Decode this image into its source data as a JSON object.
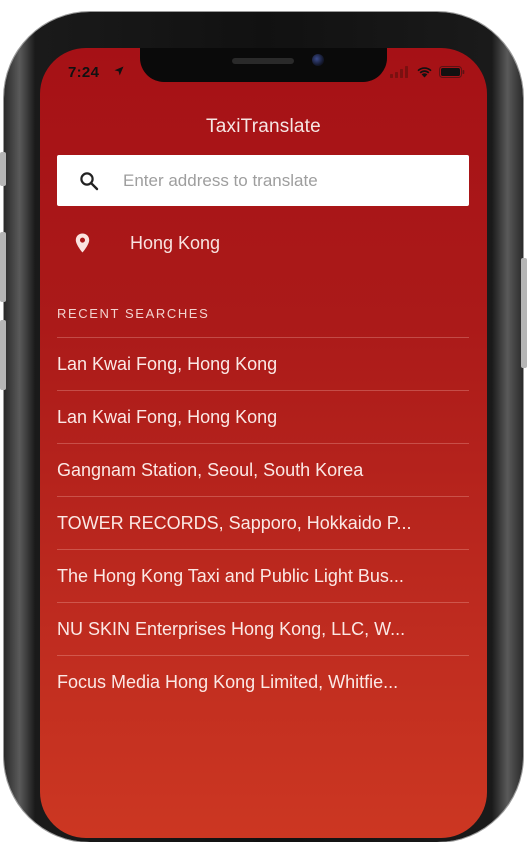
{
  "status_bar": {
    "time": "7:24"
  },
  "app": {
    "title": "TaxiTranslate"
  },
  "search": {
    "placeholder": "Enter address to translate",
    "value": ""
  },
  "current_location": {
    "label": "Hong Kong"
  },
  "recent_searches": {
    "header": "RECENT SEARCHES",
    "items": [
      "Lan Kwai Fong, Hong Kong",
      "Lan Kwai Fong, Hong Kong",
      "Gangnam Station, Seoul, South Korea",
      "TOWER RECORDS, Sapporo, Hokkaido P...",
      "The Hong Kong Taxi and Public Light Bus...",
      "NU SKIN Enterprises Hong Kong, LLC, W...",
      "Focus Media Hong Kong Limited, Whitfie..."
    ]
  },
  "icons": {
    "search": "search-icon",
    "pin": "location-pin-icon",
    "location_arrow": "location-arrow-icon",
    "signal": "cellular-signal-icon",
    "wifi": "wifi-icon",
    "battery": "battery-icon"
  },
  "colors": {
    "accent_top": "#a61116",
    "accent_bottom": "#cc3722",
    "search_bg": "#ffffff"
  }
}
